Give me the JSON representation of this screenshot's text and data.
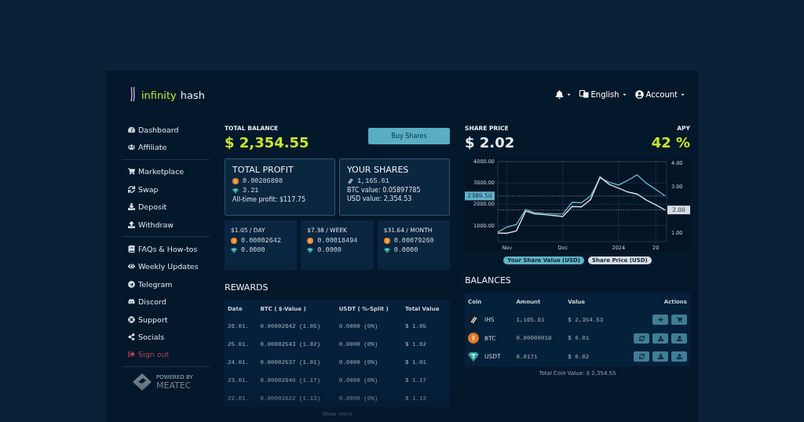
{
  "brand": {
    "name_first": "infinity",
    "name_second": "hash",
    "powered_by": "POWERED BY",
    "partner": "MEATEC"
  },
  "header": {
    "language": "English",
    "account": "Account"
  },
  "sidebar": {
    "groups": [
      [
        {
          "label": "Dashboard",
          "kind": "link"
        },
        {
          "label": "Affiliate",
          "kind": "link"
        }
      ],
      [
        {
          "label": "Marketplace",
          "kind": "link"
        },
        {
          "label": "Swap",
          "kind": "link"
        },
        {
          "label": "Deposit",
          "kind": "link"
        },
        {
          "label": "Withdraw",
          "kind": "link"
        }
      ],
      [
        {
          "label": "FAQs & How-tos",
          "kind": "link"
        },
        {
          "label": "Weekly Updates",
          "kind": "link"
        },
        {
          "label": "Telegram",
          "kind": "link"
        },
        {
          "label": "Discord",
          "kind": "link"
        },
        {
          "label": "Support",
          "kind": "link"
        },
        {
          "label": "Socials",
          "kind": "link"
        },
        {
          "label": "Sign out",
          "kind": "signout"
        }
      ]
    ]
  },
  "balance": {
    "label": "TOTAL BALANCE",
    "amount": "$ 2,354.55",
    "button": "Buy Shares"
  },
  "total_profit": {
    "title": "TOTAL PROFIT",
    "btc": "0.00286898",
    "usdt": "3.21",
    "all_time": "All-time profit: $117.75"
  },
  "your_shares": {
    "title": "YOUR SHARES",
    "shares": "1,165.61",
    "btc_value": "BTC value: 0.05897785",
    "usd_value": "USD value: 2,354.53"
  },
  "periods": [
    {
      "title": "$1.05 / DAY",
      "btc": "0.00002642",
      "usdt": "0.0000"
    },
    {
      "title": "$7.38 / WEEK",
      "btc": "0.00018494",
      "usdt": "0.0000"
    },
    {
      "title": "$31.64 / MONTH",
      "btc": "0.00079260",
      "usdt": "0.0000"
    }
  ],
  "share_price": {
    "label": "SHARE PRICE",
    "amount": "$ 2.02",
    "apy_label": "APY",
    "apy": "42 %",
    "chart_data": {
      "type": "line",
      "grid": true,
      "ref_lines": [
        {
          "axis": "y",
          "value": 2389.5,
          "label": "2389.50"
        },
        {
          "axis": "y2",
          "value": 2.0,
          "label": "2.00"
        }
      ],
      "categories": [
        null,
        "Nov",
        null,
        null,
        null,
        null,
        null,
        "Dec",
        null,
        null,
        null,
        null,
        null,
        "2024",
        null,
        null,
        null,
        "20",
        null
      ],
      "ylim": [
        250,
        4000
      ],
      "yticks": [
        {
          "value": 1000,
          "label": "1000.00"
        },
        {
          "value": 2000,
          "label": "2000.00"
        },
        {
          "value": 3000,
          "label": "3000.00"
        },
        {
          "value": 4000,
          "label": "4000.00"
        }
      ],
      "y2lim": [
        0.64,
        4.08
      ],
      "y2ticks": [
        {
          "value": 1,
          "label": "1.00"
        },
        {
          "value": 3,
          "label": "3.00"
        },
        {
          "value": 4,
          "label": "4.00"
        }
      ],
      "series": [
        {
          "name": "Your Share Value (USD)",
          "color": "#5fb3c8",
          "values": [
            700,
            930,
            1050,
            1750,
            1600,
            1570,
            1550,
            1540,
            2100,
            2070,
            2390,
            3230,
            3030,
            2900,
            3120,
            3380,
            2980,
            2700,
            2390
          ]
        },
        {
          "name": "Share Price (USD)",
          "color": "#d8dde2",
          "axis": "y2",
          "values": [
            1.0,
            1.0,
            1.1,
            1.95,
            1.83,
            1.8,
            1.76,
            1.72,
            2.15,
            2.13,
            2.45,
            3.42,
            3.1,
            2.94,
            2.77,
            2.68,
            2.42,
            2.22,
            2.0
          ]
        }
      ]
    }
  },
  "rewards": {
    "title": "REWARDS",
    "columns": [
      "Date",
      "BTC ( $-Value )",
      "USDT ( %-Split )",
      "Total Value"
    ],
    "rows": [
      [
        "26.01.",
        "0.00002642 (1.05)",
        "0.0000 (0%)",
        "$ 1.05"
      ],
      [
        "25.01.",
        "0.00002543 (1.02)",
        "0.0000 (0%)",
        "$ 1.02"
      ],
      [
        "24.01.",
        "0.00002537 (1.01)",
        "0.0000 (0%)",
        "$ 1.01"
      ],
      [
        "23.01.",
        "0.00002940 (1.17)",
        "0.0000 (0%)",
        "$ 1.17"
      ],
      [
        "22.01.",
        "0.00002822 (1.13)",
        "0.0000 (0%)",
        "$ 1.13"
      ]
    ],
    "show_more": "Show more"
  },
  "balances": {
    "title": "BALANCES",
    "columns": [
      "Coin",
      "Amount",
      "Value",
      "Actions"
    ],
    "rows": [
      {
        "coin": "IHS",
        "kind": "ihs",
        "amount": "1,165.61",
        "value": "$ 2,354.53",
        "actions": [
          {
            "kind": "add"
          },
          {
            "kind": "buy"
          }
        ]
      },
      {
        "coin": "BTC",
        "kind": "btc",
        "amount": "0.00000018",
        "value": "$ 0.01",
        "actions": [
          {
            "kind": "swap"
          },
          {
            "kind": "deposit"
          },
          {
            "kind": "withdraw"
          }
        ]
      },
      {
        "coin": "USDT",
        "kind": "usdt",
        "amount": "0.0171",
        "value": "$ 0.02",
        "actions": [
          {
            "kind": "swap"
          },
          {
            "kind": "deposit"
          },
          {
            "kind": "withdraw"
          }
        ]
      }
    ],
    "total": "Total Coin Value: $ 2,354.55"
  }
}
